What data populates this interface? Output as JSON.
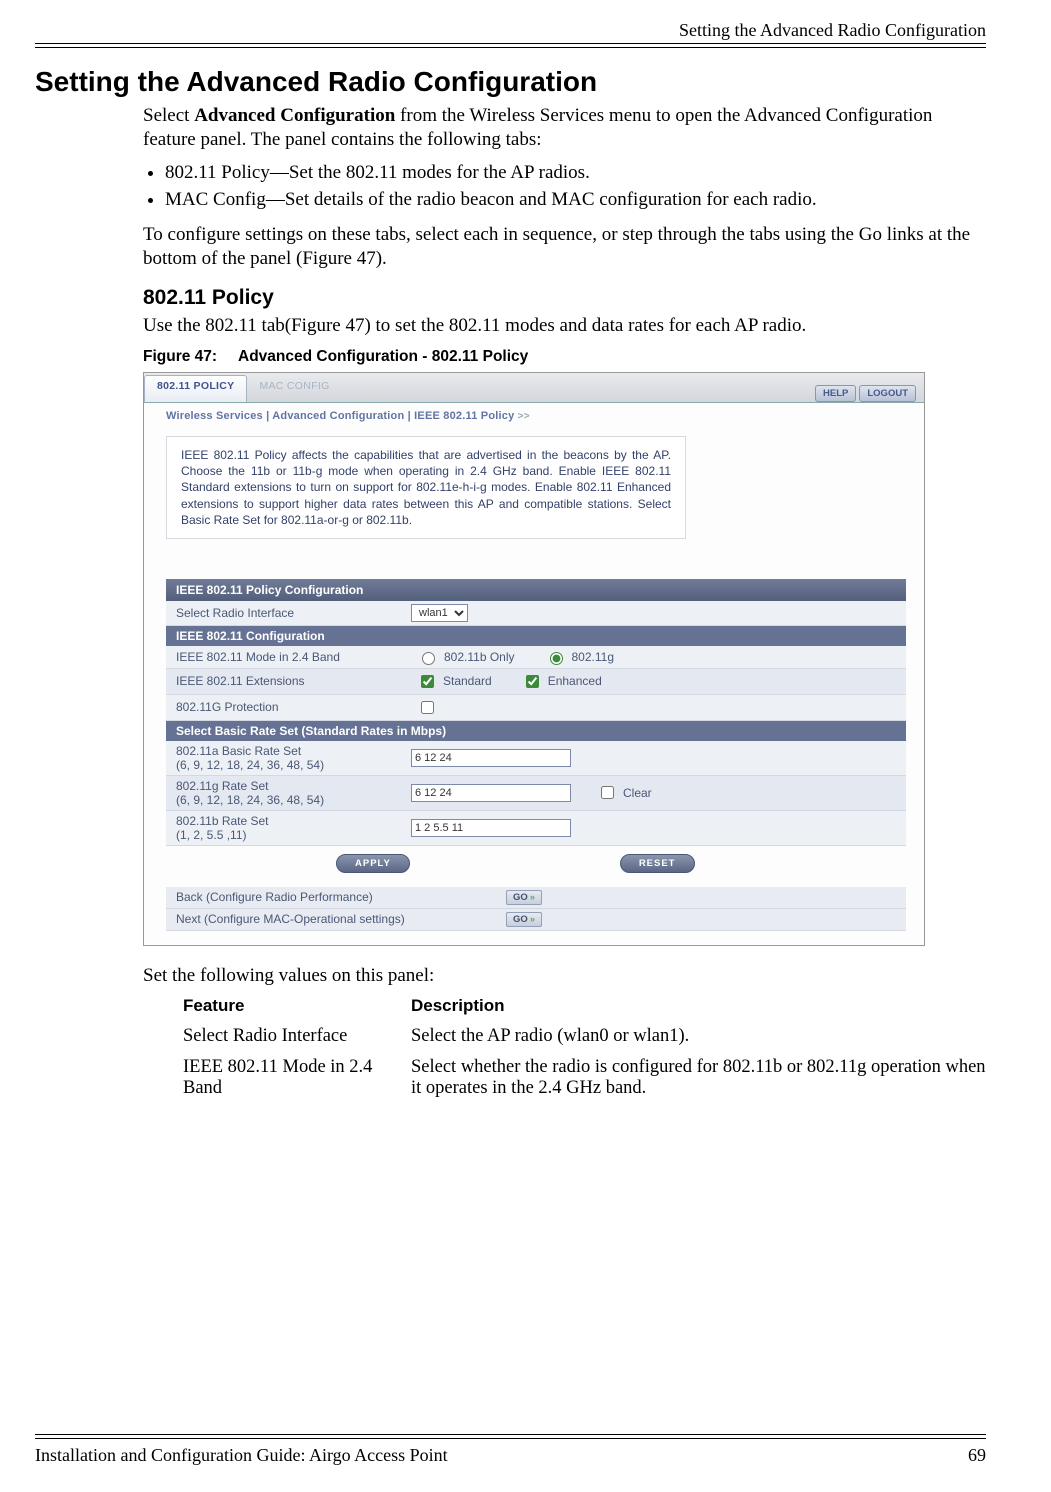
{
  "header": {
    "right_title": "Setting the Advanced Radio Configuration"
  },
  "h1": "Setting the Advanced Radio Configuration",
  "intro_pre": "Select ",
  "intro_bold": "Advanced Configuration",
  "intro_post": " from the Wireless Services menu to open the Advanced Configuration feature panel. The panel contains the following tabs:",
  "bullets": [
    "802.11 Policy—Set the 802.11 modes for the AP radios.",
    "MAC Config—Set details of the radio beacon and MAC configuration for each radio."
  ],
  "after_bullets": "To configure settings on these tabs, select each in sequence, or step through the tabs using the Go links at the bottom of the panel (Figure 47).",
  "h2": "802.11 Policy",
  "h2_para": "Use the 802.11 tab(Figure 47) to set the 802.11 modes and data rates for each AP radio.",
  "fig": {
    "label": "Figure 47:",
    "title": "Advanced Configuration - 802.11 Policy"
  },
  "shot": {
    "tabs": {
      "active": "802.11 POLICY",
      "other": "MAC CONFIG"
    },
    "buttons": {
      "help": "HELP",
      "logout": "LOGOUT"
    },
    "breadcrumb": "Wireless Services | Advanced Configuration | IEEE 802.11 Policy",
    "breadcrumb_sep": ">>",
    "info_text": "IEEE 802.11 Policy affects the capabilities that are advertised in the beacons by the AP. Choose the 11b or 11b-g mode when operating in 2.4 GHz band. Enable IEEE 802.11 Standard extensions to turn on support for 802.11e-h-i-g modes. Enable 802.11 Enhanced extensions to support higher data rates between this AP and compatible stations. Select Basic Rate Set for 802.11a-or-g or 802.11b.",
    "section1": "IEEE 802.11 Policy Configuration",
    "row_radio_label": "Select Radio Interface",
    "row_radio_value": "wlan1",
    "section2": "IEEE 802.11 Configuration",
    "row_mode_label": "IEEE 802.11 Mode in 2.4 Band",
    "row_mode_opt1": "802.11b Only",
    "row_mode_opt2": "802.11g",
    "row_ext_label": "IEEE 802.11 Extensions",
    "row_ext_opt1": "Standard",
    "row_ext_opt2": "Enhanced",
    "row_prot_label": "802.11G Protection",
    "section3": "Select Basic Rate Set (Standard Rates in Mbps)",
    "row_11a_label": "802.11a Basic Rate Set\n(6, 9, 12, 18, 24, 36, 48, 54)",
    "row_11a_value": "6 12 24",
    "row_11g_label": "802.11g Rate Set\n(6, 9, 12, 18, 24, 36, 48, 54)",
    "row_11g_value": "6 12 24",
    "row_11g_clear": "Clear",
    "row_11b_label": "802.11b Rate Set\n(1, 2, 5.5 ,11)",
    "row_11b_value": "1 2 5.5 11",
    "btn_apply": "APPLY",
    "btn_reset": "RESET",
    "nav_back": "Back (Configure Radio Performance)",
    "nav_next": "Next (Configure MAC-Operational settings)",
    "go": "GO"
  },
  "post_fig": "Set the following values on this panel:",
  "table": {
    "h1": "Feature",
    "h2": "Description",
    "rows": [
      {
        "l": "Select Radio Interface",
        "r": "Select the AP radio (wlan0 or wlan1)."
      },
      {
        "l": "IEEE 802.11 Mode in 2.4 Band",
        "r": "Select whether the radio is configured for 802.11b or 802.11g operation when it operates in the 2.4 GHz band."
      }
    ]
  },
  "footer": {
    "left": "Installation and Configuration Guide: Airgo Access Point",
    "right": "69"
  }
}
